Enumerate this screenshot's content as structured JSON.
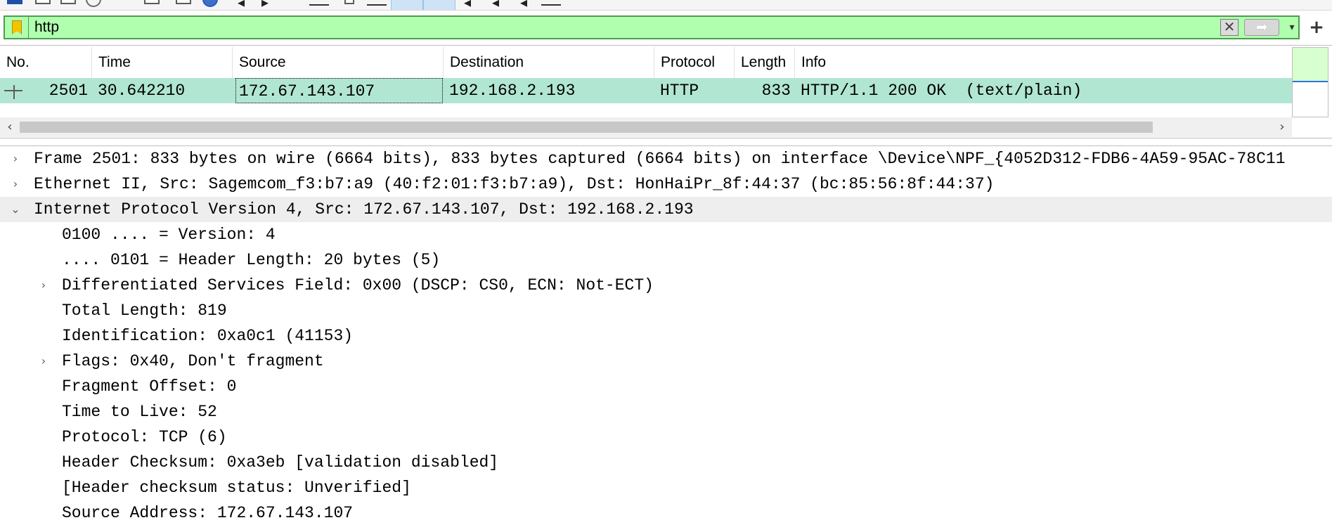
{
  "filter": {
    "value": "http",
    "clear_glyph": "✕",
    "apply_glyph": "➡",
    "history_glyph": "▾",
    "add_glyph": "+"
  },
  "packet_list": {
    "columns": [
      "No.",
      "Time",
      "Source",
      "Destination",
      "Protocol",
      "Length",
      "Info"
    ],
    "rows": [
      {
        "no": "2501",
        "time": "30.642210",
        "source": "172.67.143.107",
        "destination": "192.168.2.193",
        "protocol": "HTTP",
        "length": "833",
        "info": "HTTP/1.1 200 OK  (text/plain)"
      }
    ],
    "row_color": "#b1e6d3",
    "scroll_left": "‹",
    "scroll_right": "›"
  },
  "details": {
    "collapsed_glyph": "›",
    "expanded_glyph": "⌄",
    "rows": [
      {
        "level": 0,
        "state": "collapsed",
        "text": "Frame 2501: 833 bytes on wire (6664 bits), 833 bytes captured (6664 bits) on interface \\Device\\NPF_{4052D312-FDB6-4A59-95AC-78C11"
      },
      {
        "level": 0,
        "state": "collapsed",
        "text": "Ethernet II, Src: Sagemcom_f3:b7:a9 (40:f2:01:f3:b7:a9), Dst: HonHaiPr_8f:44:37 (bc:85:56:8f:44:37)"
      },
      {
        "level": 0,
        "state": "expanded",
        "text": "Internet Protocol Version 4, Src: 172.67.143.107, Dst: 192.168.2.193"
      },
      {
        "level": 1,
        "state": "leaf",
        "text": "0100 .... = Version: 4"
      },
      {
        "level": 1,
        "state": "leaf",
        "text": ".... 0101 = Header Length: 20 bytes (5)"
      },
      {
        "level": 1,
        "state": "collapsed",
        "text": "Differentiated Services Field: 0x00 (DSCP: CS0, ECN: Not-ECT)"
      },
      {
        "level": 1,
        "state": "leaf",
        "text": "Total Length: 819"
      },
      {
        "level": 1,
        "state": "leaf",
        "text": "Identification: 0xa0c1 (41153)"
      },
      {
        "level": 1,
        "state": "collapsed",
        "text": "Flags: 0x40, Don't fragment"
      },
      {
        "level": 1,
        "state": "leaf",
        "text": "Fragment Offset: 0"
      },
      {
        "level": 1,
        "state": "leaf",
        "text": "Time to Live: 52"
      },
      {
        "level": 1,
        "state": "leaf",
        "text": "Protocol: TCP (6)"
      },
      {
        "level": 1,
        "state": "leaf",
        "text": "Header Checksum: 0xa3eb [validation disabled]"
      },
      {
        "level": 1,
        "state": "leaf",
        "text": "[Header checksum status: Unverified]"
      },
      {
        "level": 1,
        "state": "leaf",
        "text": "Source Address: 172.67.143.107"
      }
    ]
  },
  "colors": {
    "filter_valid_bg": "#afffaf",
    "selected_row_bg": "#b1e6d3",
    "highlight_row_bg": "#eeeeee"
  }
}
